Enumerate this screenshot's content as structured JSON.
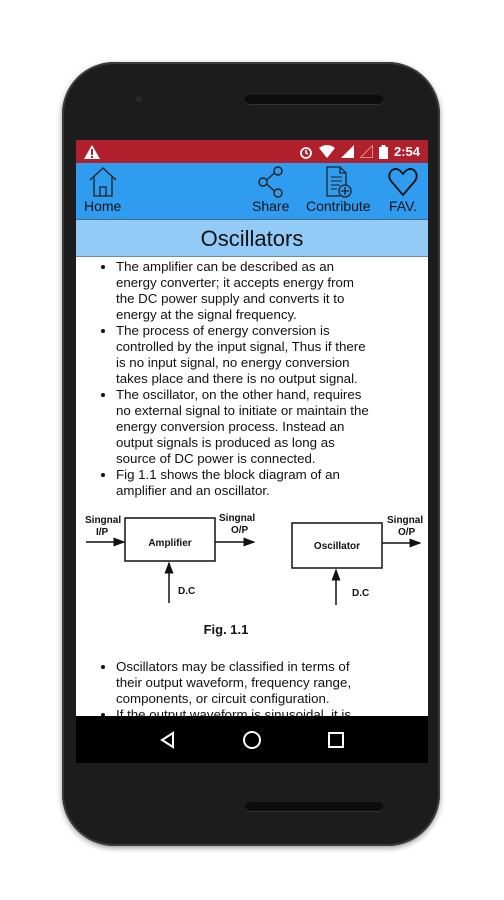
{
  "status_bar": {
    "time": "2:54",
    "icons": [
      "warning-icon",
      "alarm-icon",
      "wifi-icon",
      "signal-icon",
      "signal-empty-icon",
      "battery-icon"
    ]
  },
  "toolbar": {
    "home": "Home",
    "share": "Share",
    "contribute": "Contribute",
    "fav": "FAV."
  },
  "title": "Oscillators",
  "bullets_top": [
    "The amplifier can be described as an energy converter; it accepts energy from the DC power supply and converts it to energy at the signal frequency.",
    "The process of energy conversion is controlled by the input signal, Thus if there is no input signal, no energy conversion takes place and there is no output signal.",
    "The oscillator, on the other hand, requires no external signal to initiate or maintain the energy conversion process. Instead an output signals is produced as long as source of DC power is connected.",
    "Fig 1.1 shows the block diagram of an amplifier and an oscillator."
  ],
  "figure": {
    "amp_in": [
      "Singnal",
      "I/P"
    ],
    "amp_out": [
      "Singnal",
      "O/P"
    ],
    "amp_block": "Amplifier",
    "amp_dc": "D.C",
    "osc_out": [
      "Singnal",
      "O/P"
    ],
    "osc_block": "Oscillator",
    "osc_dc": "D.C",
    "caption": "Fig. 1.1"
  },
  "bullets_bottom": [
    "Oscillators may be classified in terms of their output waveform, frequency range, components, or circuit configuration.",
    "If the output waveform is sinusoidal, it is called a harmonic oscillator."
  ],
  "colors": {
    "status_bar": "#b0202c",
    "toolbar": "#2f9cf0",
    "title_bar": "#92cbf7"
  }
}
